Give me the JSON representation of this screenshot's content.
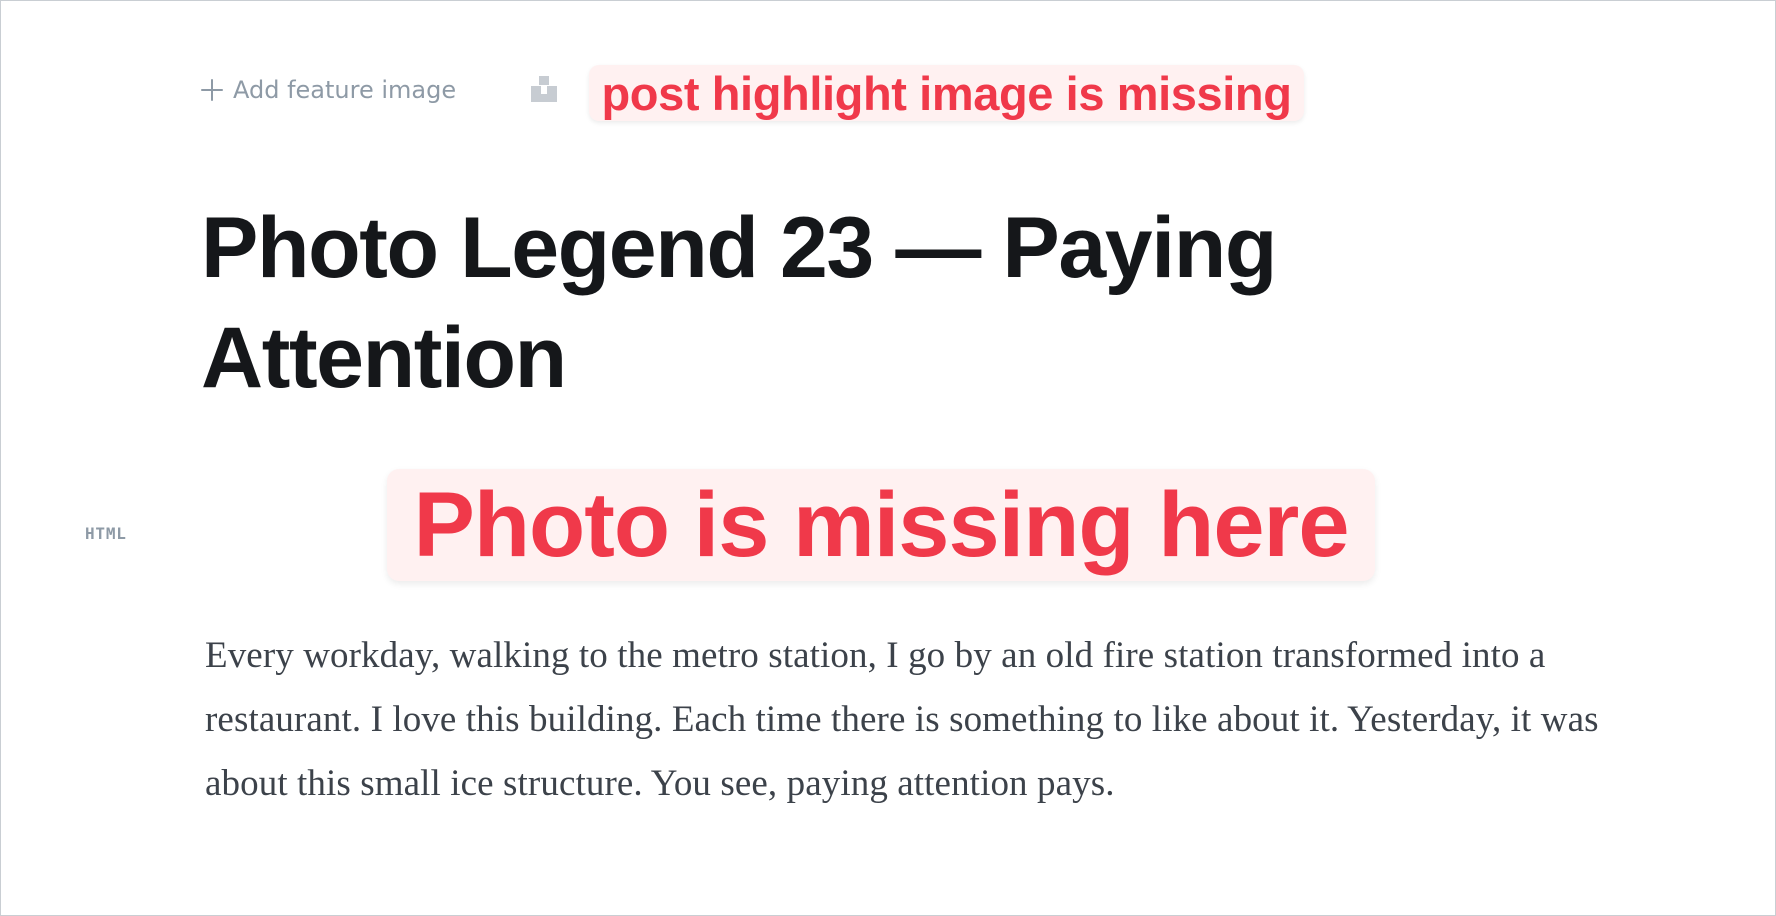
{
  "editor": {
    "add_feature_image_label": "Add feature image",
    "post_highlight_notice": "post highlight image is missing",
    "title": "Photo Legend 23 — Paying Attention",
    "card_label": "HTML",
    "photo_notice": "Photo is missing here",
    "body": "Every workday, walking to the metro station, I go by an old fire station transformed into a restaurant. I love this building. Each time there is something to like about it. Yesterday, it was about this small ice structure. You see, paying attention pays."
  },
  "icons": {
    "add": "plus-icon",
    "feature_image": "broken-image-icon"
  },
  "colors": {
    "accent_red": "#f0394a",
    "notice_background": "#fff1f1",
    "title": "#15171a",
    "body": "#3c424a",
    "muted": "#8e9aa6"
  }
}
